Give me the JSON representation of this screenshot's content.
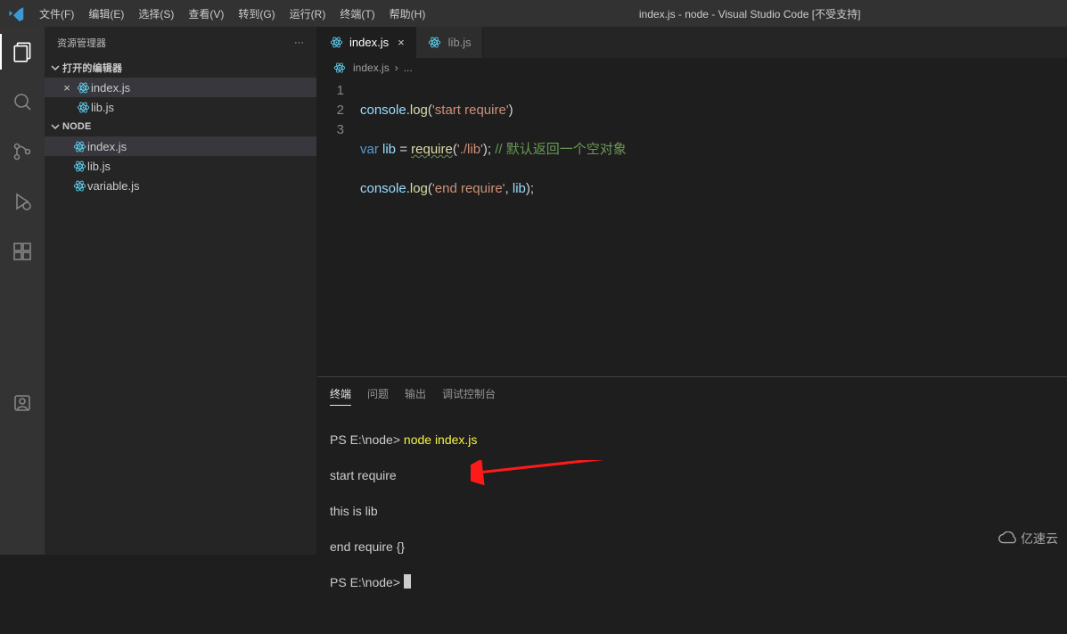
{
  "titlebar": {
    "menus": [
      "文件(F)",
      "编辑(E)",
      "选择(S)",
      "查看(V)",
      "转到(G)",
      "运行(R)",
      "终端(T)",
      "帮助(H)"
    ],
    "title": "index.js - node - Visual Studio Code [不受支持]"
  },
  "sidebar": {
    "header": "资源管理器",
    "more": "···",
    "open_editors_label": "打开的编辑器",
    "open_editors": [
      {
        "name": "index.js",
        "active": true,
        "close": "×"
      },
      {
        "name": "lib.js",
        "active": false,
        "close": ""
      }
    ],
    "folder_label": "NODE",
    "folder_items": [
      {
        "name": "index.js",
        "active": true
      },
      {
        "name": "lib.js",
        "active": false
      },
      {
        "name": "variable.js",
        "active": false
      }
    ]
  },
  "tabs": [
    {
      "name": "index.js",
      "active": true,
      "close": "×"
    },
    {
      "name": "lib.js",
      "active": false,
      "close": ""
    }
  ],
  "breadcrumb": {
    "file": "index.js",
    "sep": "›",
    "tail": "..."
  },
  "code": {
    "lines": [
      "1",
      "2",
      "3"
    ],
    "l1": {
      "a": "console",
      "b": ".",
      "c": "log",
      "d": "(",
      "e": "'start require'",
      "f": ")"
    },
    "l2": {
      "a": "var ",
      "b": "lib",
      "c": " = ",
      "d": "require",
      "e": "(",
      "f": "'./lib'",
      "g": ");",
      "h": " // 默认返回一个空对象"
    },
    "l3": {
      "a": "console",
      "b": ".",
      "c": "log",
      "d": "(",
      "e": "'end require'",
      "f": ", ",
      "g": "lib",
      "h": ");"
    }
  },
  "panel": {
    "tabs": [
      "终端",
      "问题",
      "输出",
      "调试控制台"
    ],
    "active": 0,
    "term": {
      "p1a": "PS E:\\node> ",
      "p1b": "node index.js",
      "p2": "start require",
      "p3": "this is lib",
      "p4": "end require {}",
      "p5": "PS E:\\node> "
    }
  },
  "watermark": "亿速云"
}
